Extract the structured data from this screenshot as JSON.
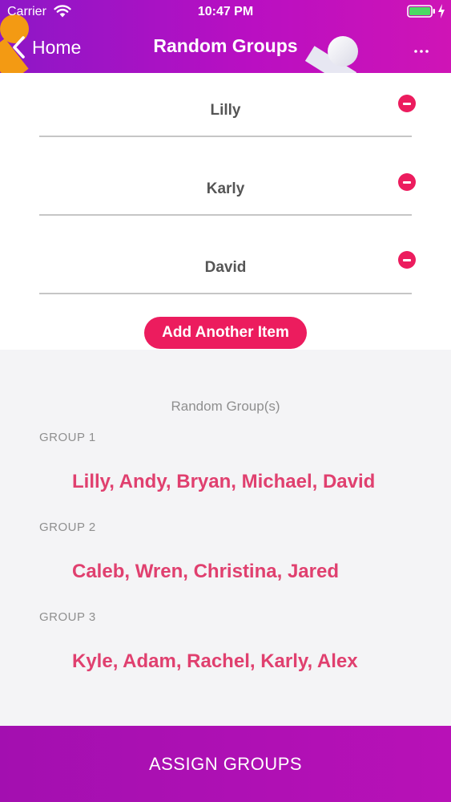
{
  "status_bar": {
    "carrier": "Carrier",
    "time": "10:47 PM"
  },
  "nav": {
    "back_label": "Home",
    "title": "Random Groups",
    "more_icon": "more-dots-icon"
  },
  "items": [
    {
      "name": "Lilly"
    },
    {
      "name": "Karly"
    },
    {
      "name": "David"
    }
  ],
  "add_button_label": "Add Another Item",
  "groups_section": {
    "heading": "Random Group(s)",
    "groups": [
      {
        "label": "GROUP 1",
        "members": "Lilly, Andy, Bryan, Michael, David"
      },
      {
        "label": "GROUP 2",
        "members": "Caleb, Wren, Christina, Jared"
      },
      {
        "label": "GROUP 3",
        "members": "Kyle, Adam, Rachel, Karly, Alex"
      }
    ]
  },
  "assign_button_label": "ASSIGN GROUPS",
  "colors": {
    "header_gradient_start": "#8d17c7",
    "header_gradient_end": "#cf14b6",
    "accent_pink": "#ec1c5e",
    "member_text": "#e0406f",
    "assign_button": "#a30fb0"
  }
}
